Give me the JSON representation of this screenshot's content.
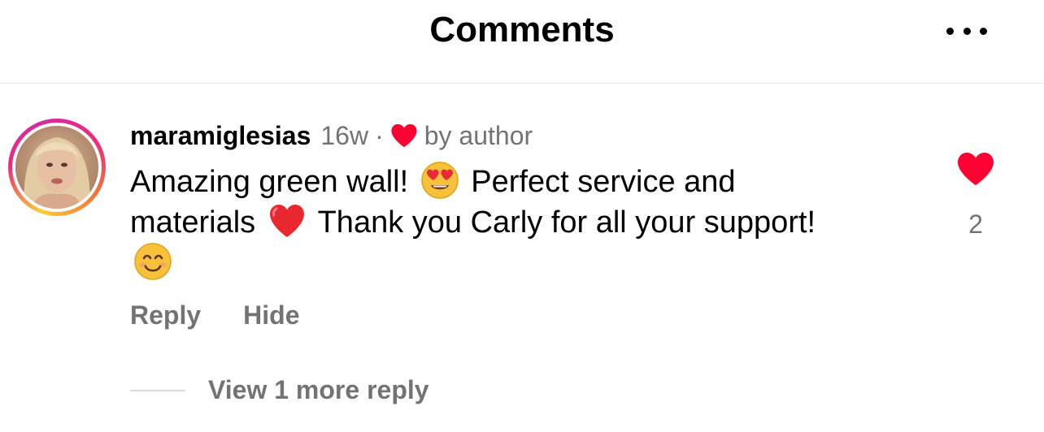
{
  "header": {
    "title": "Comments",
    "more_icon": "more-horizontal-icon"
  },
  "comment": {
    "username": "maramiglesias",
    "time": "16w",
    "separator": "·",
    "author_badge": "by author",
    "author_heart_color": "#ff0033",
    "text_part1": "Amazing green wall!",
    "emoji1": "heart-eyes-emoji",
    "text_part2": "Perfect service and materials",
    "emoji2": "red-heart-emoji",
    "text_part3": "Thank you Carly for all your support!",
    "emoji3": "smiling-face-emoji",
    "reply_label": "Reply",
    "hide_label": "Hide",
    "like_count": "2",
    "liked": true,
    "like_color": "#ff0033"
  },
  "replies": {
    "view_more_label": "View 1 more reply"
  },
  "colors": {
    "secondary_text": "#737373",
    "divider": "#e6e6e6"
  }
}
